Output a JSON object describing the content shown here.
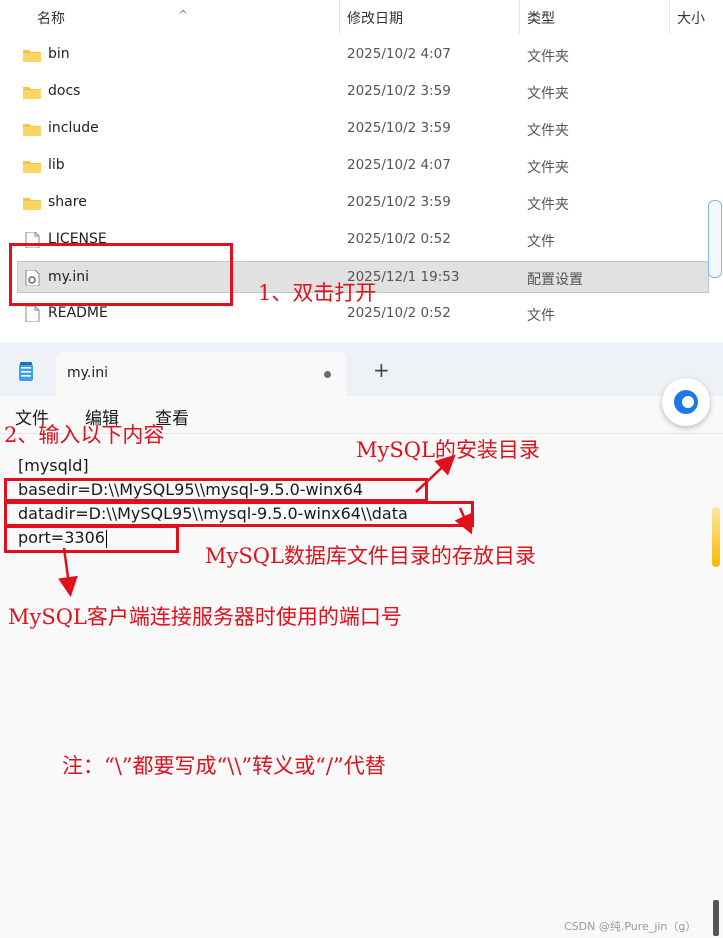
{
  "explorer": {
    "columns": {
      "name": "名称",
      "date": "修改日期",
      "type": "类型",
      "size": "大小"
    },
    "files": [
      {
        "name": "bin",
        "date": "2025/10/2 4:07",
        "type": "文件夹",
        "icon": "folder-icon"
      },
      {
        "name": "docs",
        "date": "2025/10/2 3:59",
        "type": "文件夹",
        "icon": "folder-icon"
      },
      {
        "name": "include",
        "date": "2025/10/2 3:59",
        "type": "文件夹",
        "icon": "folder-icon"
      },
      {
        "name": "lib",
        "date": "2025/10/2 4:07",
        "type": "文件夹",
        "icon": "folder-icon"
      },
      {
        "name": "share",
        "date": "2025/10/2 3:59",
        "type": "文件夹",
        "icon": "folder-icon"
      },
      {
        "name": "LICENSE",
        "date": "2025/10/2 0:52",
        "type": "文件",
        "icon": "file-icon"
      },
      {
        "name": "my.ini",
        "date": "2025/12/1 19:53",
        "type": "配置设置",
        "icon": "settings-file-icon",
        "selected": true
      },
      {
        "name": "README",
        "date": "2025/10/2 0:52",
        "type": "文件",
        "icon": "file-icon"
      }
    ]
  },
  "notepad": {
    "tab_title": "my.ini",
    "new_tab": "+",
    "menu": [
      "文件",
      "编辑",
      "查看"
    ],
    "lines": [
      "[mysqld]",
      "basedir=D:\\\\MySQL95\\\\mysql-9.5.0-winx64",
      "datadir=D:\\\\MySQL95\\\\mysql-9.5.0-winx64\\\\data",
      "port=3306"
    ]
  },
  "annotations": {
    "step1": "1、双击打开",
    "step2": "2、输入以下内容",
    "basedir_note": "MySQL的安装目录",
    "datadir_note": "MySQL数据库文件目录的存放目录",
    "port_note": "MySQL客户端连接服务器时使用的端口号",
    "escape_note": "注：“\\”都要写成“\\\\”转义或“/”代替"
  },
  "watermark": "CSDN @纯.Pure_jin（g）",
  "colors": {
    "annotation": "#e0101c",
    "folder": "#f5c542",
    "selection": "#e1e1e1"
  }
}
